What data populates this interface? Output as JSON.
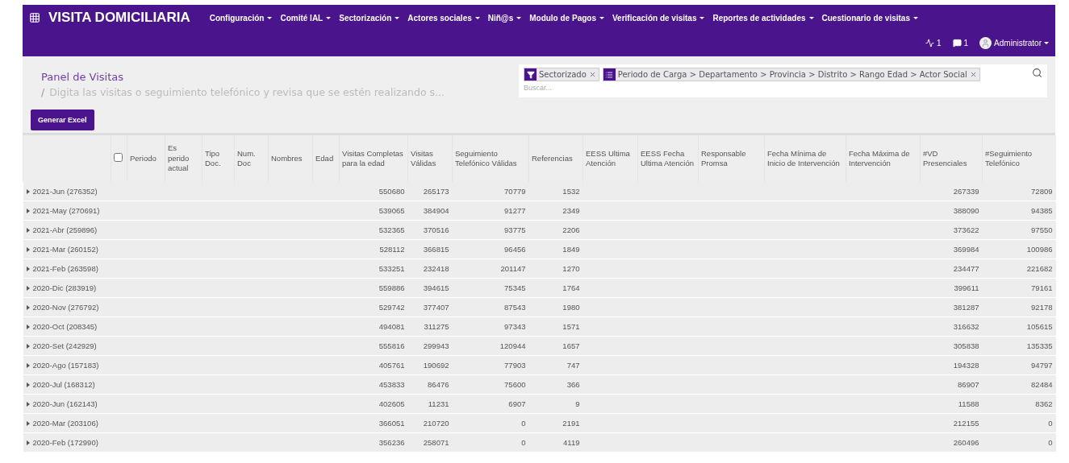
{
  "app": {
    "title": "VISITA DOMICILIARIA"
  },
  "menu": [
    {
      "label": "Configuración"
    },
    {
      "label": "Comité IAL"
    },
    {
      "label": "Sectorización"
    },
    {
      "label": "Actores sociales"
    },
    {
      "label": "Niñ@s"
    },
    {
      "label": "Modulo de Pagos"
    },
    {
      "label": "Verificación de visitas"
    },
    {
      "label": "Reportes de actividades"
    },
    {
      "label": "Cuestionario de visitas"
    }
  ],
  "systray": {
    "activities": "1",
    "messages": "1",
    "user": "Administrator"
  },
  "breadcrumb": {
    "title": "Panel de Visitas",
    "separator": "/",
    "subtitle": "Digita las visitas o seguimiento telefónico y revisa que se estén realizando s..."
  },
  "buttons": [
    {
      "label": "Generar Excel"
    }
  ],
  "search": {
    "placeholder": "Buscar...",
    "facets": [
      {
        "kind": "filter",
        "value": "Sectorizado"
      },
      {
        "kind": "groupby",
        "value": "Periodo de Carga > Departamento > Provincia > Distrito > Rango Edad > Actor Social"
      }
    ]
  },
  "table": {
    "select_all": {
      "checked": false
    },
    "columns": [
      "Periodo",
      "Es perido actual",
      "Tipo Doc.",
      "Num. Doc",
      "Nombres",
      "Edad",
      "Visitas Completas para la edad",
      "Visitas Válidas",
      "Seguimiento Telefónico Válidas",
      "Referencias",
      "EESS Ultima Atención",
      "EESS Fecha Ultima Atención",
      "Responsable Promsa",
      "Fecha Mínima de Inicio de Intervención",
      "Fecha Máxima de Intervención",
      "#VD Presenciales",
      "#Seguimiento Telefónico"
    ],
    "rows": [
      {
        "group": "2021-Jun (276352)",
        "expanded": false,
        "completas": "550680",
        "validas": "265173",
        "seguimiento": "70779",
        "referencias": "1532",
        "vd": "267339",
        "seg_tel": "72809"
      },
      {
        "group": "2021-May (270691)",
        "expanded": false,
        "completas": "539065",
        "validas": "384904",
        "seguimiento": "91277",
        "referencias": "2349",
        "vd": "388090",
        "seg_tel": "94385"
      },
      {
        "group": "2021-Abr (259896)",
        "expanded": false,
        "completas": "532365",
        "validas": "370516",
        "seguimiento": "93775",
        "referencias": "2206",
        "vd": "373622",
        "seg_tel": "97550"
      },
      {
        "group": "2021-Mar (260152)",
        "expanded": false,
        "completas": "528112",
        "validas": "366815",
        "seguimiento": "96456",
        "referencias": "1849",
        "vd": "369984",
        "seg_tel": "100986"
      },
      {
        "group": "2021-Feb (263598)",
        "expanded": false,
        "completas": "533251",
        "validas": "232418",
        "seguimiento": "201147",
        "referencias": "1270",
        "vd": "234477",
        "seg_tel": "221682"
      },
      {
        "group": "2020-Dic (283919)",
        "expanded": false,
        "completas": "559886",
        "validas": "394615",
        "seguimiento": "75345",
        "referencias": "1764",
        "vd": "399611",
        "seg_tel": "79161"
      },
      {
        "group": "2020-Nov (276792)",
        "expanded": false,
        "completas": "529742",
        "validas": "377407",
        "seguimiento": "87543",
        "referencias": "1980",
        "vd": "381287",
        "seg_tel": "92178"
      },
      {
        "group": "2020-Oct (208345)",
        "expanded": false,
        "completas": "494081",
        "validas": "311275",
        "seguimiento": "97343",
        "referencias": "1571",
        "vd": "316632",
        "seg_tel": "105615"
      },
      {
        "group": "2020-Set (242929)",
        "expanded": false,
        "completas": "555816",
        "validas": "299943",
        "seguimiento": "120944",
        "referencias": "1657",
        "vd": "305838",
        "seg_tel": "135335"
      },
      {
        "group": "2020-Ago (157183)",
        "expanded": false,
        "completas": "405761",
        "validas": "190692",
        "seguimiento": "77903",
        "referencias": "747",
        "vd": "194328",
        "seg_tel": "94797"
      },
      {
        "group": "2020-Jul (168312)",
        "expanded": false,
        "completas": "453833",
        "validas": "86476",
        "seguimiento": "75600",
        "referencias": "366",
        "vd": "86907",
        "seg_tel": "82484"
      },
      {
        "group": "2020-Jun (162143)",
        "expanded": false,
        "completas": "402605",
        "validas": "11231",
        "seguimiento": "6907",
        "referencias": "9",
        "vd": "11588",
        "seg_tel": "8362"
      },
      {
        "group": "2020-Mar (203106)",
        "expanded": false,
        "completas": "366051",
        "validas": "210720",
        "seguimiento": "0",
        "referencias": "2191",
        "vd": "212155",
        "seg_tel": "0"
      },
      {
        "group": "2020-Feb (172990)",
        "expanded": false,
        "completas": "356236",
        "validas": "258071",
        "seguimiento": "0",
        "referencias": "4119",
        "vd": "260496",
        "seg_tel": "0"
      }
    ]
  }
}
